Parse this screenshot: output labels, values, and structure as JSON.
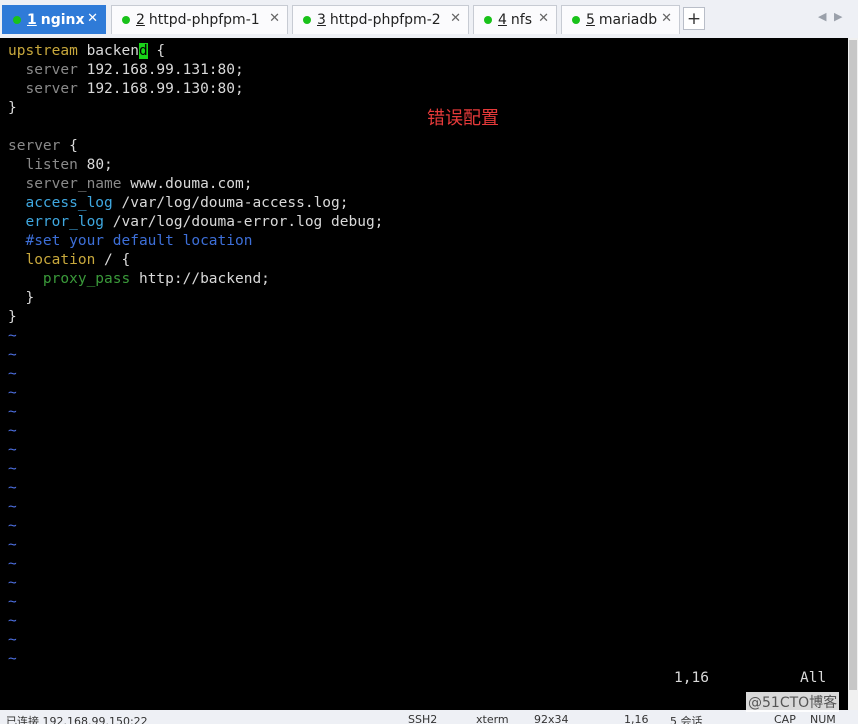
{
  "tabs": [
    {
      "num": "1",
      "name": "nginx",
      "active": true
    },
    {
      "num": "2",
      "name": "httpd-phpfpm-1",
      "active": false
    },
    {
      "num": "3",
      "name": "httpd-phpfpm-2",
      "active": false
    },
    {
      "num": "4",
      "name": "nfs",
      "active": false
    },
    {
      "num": "5",
      "name": "mariadb",
      "active": false
    }
  ],
  "tab_close_glyph": "✕",
  "add_tab_glyph": "+",
  "nav_prev": "◀",
  "nav_next": "▶",
  "editor": {
    "upstream_kw": "upstream",
    "upstream_name_pre": "backen",
    "upstream_name_cursor": "d",
    "upstream_open": " {",
    "server_kw": "server",
    "server1": " 192.168.99.131:80;",
    "server2": " 192.168.99.130:80;",
    "close_brace": "}",
    "server_block_kw": "server",
    "server_block_open": " {",
    "listen_kw": "listen",
    "listen_val": " 80;",
    "server_name_kw": "server_name",
    "server_name_val": " www.douma.com;",
    "access_log_kw": "access_log",
    "access_log_val": " /var/log/douma-access.log;",
    "error_log_kw": "error_log",
    "error_log_val": " /var/log/douma-error.log debug;",
    "comment": "#set your default location",
    "location_kw": "location",
    "location_val": " / {",
    "proxy_pass_kw": "proxy_pass",
    "proxy_pass_val": " http://backend;",
    "inner_close": "}",
    "outer_close": "}",
    "tilde": "~",
    "ruler_pos": "1,16",
    "ruler_all": "All"
  },
  "annotation": "错误配置",
  "status": {
    "connected": "已连接 192.168.99.150:22",
    "protocol": "SSH2",
    "term": "xterm",
    "size": "92x34",
    "pos": "1,16",
    "sessions": "5 会话",
    "caps": "CAP",
    "num": "NUM"
  },
  "watermark": "@51CTO博客"
}
